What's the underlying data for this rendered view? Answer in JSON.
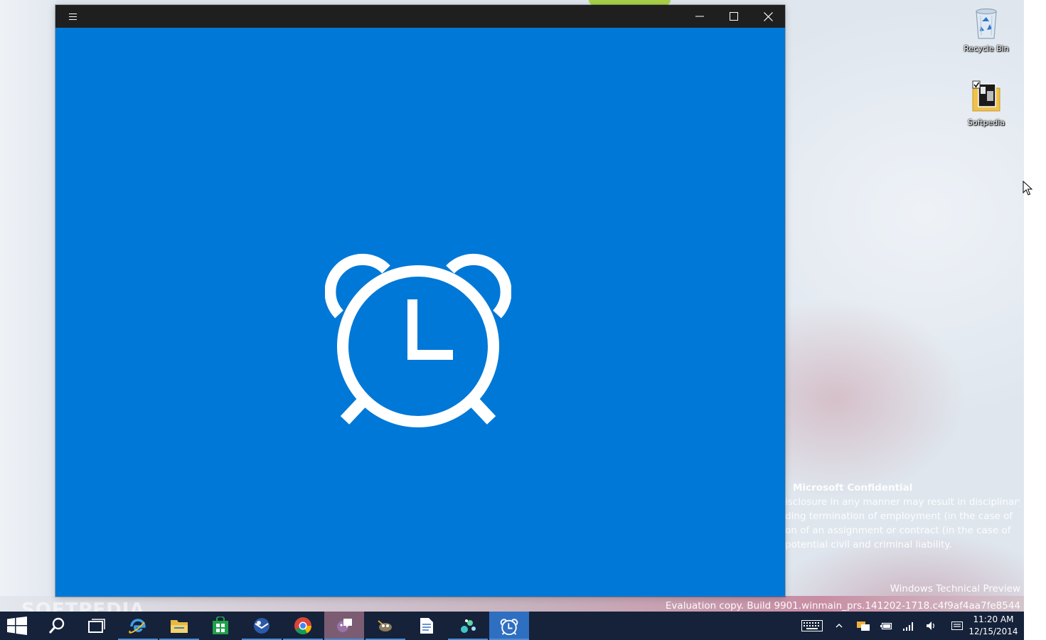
{
  "desktop": {
    "icons": [
      {
        "label": "Recycle Bin",
        "icon": "recycle-bin-icon"
      },
      {
        "label": "Softpedia",
        "icon": "folder-icon"
      }
    ],
    "watermark": {
      "title": "Microsoft Confidential",
      "lines": [
        "isclosure in any manner may result in disciplinary",
        "ding termination of employment (in the case of",
        "on of an assignment or contract (in the case of",
        "potential civil and criminal liability."
      ]
    },
    "build": {
      "edition": "Windows Technical Preview",
      "evaluation": "Evaluation copy. Build 9901.winmain_prs.141202-1718.c4f9af4aa7fe8544"
    },
    "brand_watermark": "SOFTPEDIA"
  },
  "window": {
    "background": "#0078d7",
    "titlebar_color": "#1f1f1f",
    "menu_icon": "hamburger-menu-icon",
    "controls": [
      "minimize-icon",
      "maximize-icon",
      "close-icon"
    ],
    "splash_icon": "alarm-clock-icon"
  },
  "taskbar": {
    "background": "#15223a",
    "pinned": [
      {
        "name": "start",
        "icon": "windows-logo-icon"
      },
      {
        "name": "search",
        "icon": "search-icon"
      },
      {
        "name": "task-view",
        "icon": "task-view-icon"
      },
      {
        "name": "internet-explorer",
        "icon": "internet-explorer-icon"
      },
      {
        "name": "file-explorer",
        "icon": "file-explorer-icon"
      },
      {
        "name": "store",
        "icon": "store-icon"
      },
      {
        "name": "mail-client",
        "icon": "mail-icon"
      },
      {
        "name": "chrome",
        "icon": "chrome-icon"
      },
      {
        "name": "chat-app",
        "icon": "chat-icon"
      },
      {
        "name": "gimp",
        "icon": "gimp-icon"
      },
      {
        "name": "document",
        "icon": "document-icon"
      },
      {
        "name": "paint-app",
        "icon": "paint-icon"
      },
      {
        "name": "alarms",
        "icon": "alarm-clock-icon"
      }
    ],
    "tray": {
      "time": "11:20 AM",
      "date": "12/15/2014"
    }
  }
}
